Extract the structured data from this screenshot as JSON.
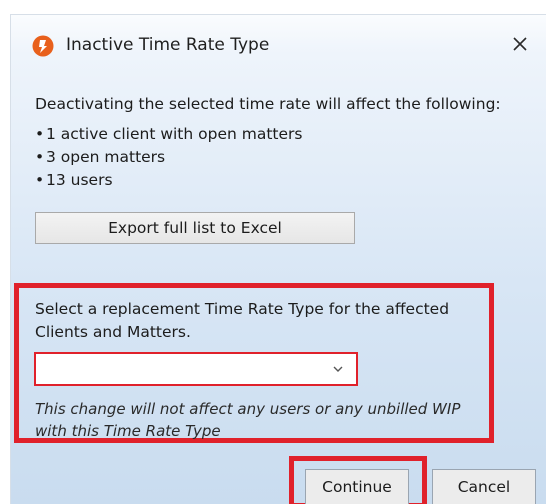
{
  "window": {
    "title": "Inactive Time Rate Type",
    "icon": "app-logo-icon",
    "close_icon": "close-icon"
  },
  "message": {
    "intro": "Deactivating the selected time rate will affect the following:",
    "bullets": [
      "1 active client with open matters",
      "3 open matters",
      "13 users"
    ]
  },
  "export_button": {
    "label": "Export full list to Excel"
  },
  "replacement": {
    "prompt": "Select a replacement Time Rate Type for the affected Clients and Matters.",
    "selected_value": "",
    "dropdown_icon": "chevron-down-icon",
    "note": "This change will not affect any users or any unbilled WIP with this Time Rate Type"
  },
  "footer": {
    "continue_label": "Continue",
    "cancel_label": "Cancel"
  },
  "colors": {
    "highlight": "#e0212b",
    "dialog_gradient_top": "#eef4fb",
    "dialog_gradient_bottom": "#c9dcef",
    "logo_orange": "#e8601c"
  }
}
